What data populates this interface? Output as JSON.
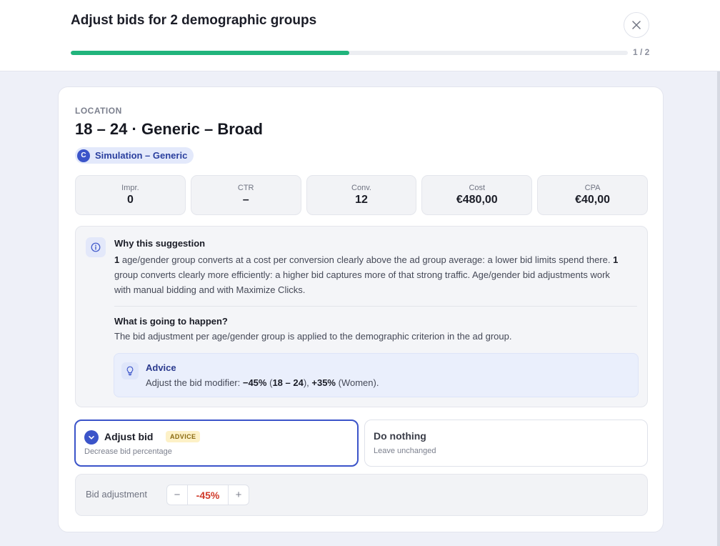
{
  "header": {
    "title": "Adjust bids for 2 demographic groups",
    "progress_text": "1 / 2",
    "progress_fraction": 0.5,
    "progress_color": "#21b47c"
  },
  "location": {
    "label": "LOCATION",
    "name": "18 – 24 · Generic – Broad",
    "campaign_badge": "C",
    "campaign": "Simulation – Generic"
  },
  "stats": [
    {
      "label": "Impr.",
      "value": "0"
    },
    {
      "label": "CTR",
      "value": "–"
    },
    {
      "label": "Conv.",
      "value": "12"
    },
    {
      "label": "Cost",
      "value": "€480,00"
    },
    {
      "label": "CPA",
      "value": "€40,00"
    }
  ],
  "reason": {
    "title": "Why this suggestion",
    "count_1": "1",
    "text_1": " age/gender group converts at a cost per conversion clearly above the ad group average: a lower bid limits spend there. ",
    "count_2": "1",
    "text_2": " group converts clearly more efficiently: a higher bid captures more of that strong traffic. Age/gender bid adjustments work with manual bidding and with Maximize Clicks.",
    "happen_title": "What is going to happen?",
    "happen_text": "The bid adjustment per age/gender group is applied to the demographic criterion in the ad group.",
    "advice_title": "Advice",
    "advice_prefix": "Adjust the bid modifier: ",
    "advice_mod_1": "−45%",
    "advice_open_1": " (",
    "advice_group_1": "18 – 24",
    "advice_close_1": "), ",
    "advice_mod_2": "+35%",
    "advice_group_2": " (Women)."
  },
  "options": {
    "adjust": {
      "title": "Adjust bid",
      "tag": "ADVICE",
      "subtitle": "Decrease bid percentage",
      "selected": true
    },
    "nothing": {
      "title": "Do nothing",
      "subtitle": "Leave unchanged",
      "selected": false
    }
  },
  "bid": {
    "label": "Bid adjustment",
    "minus": "−",
    "value": "-45%",
    "plus": "+"
  },
  "icons": {
    "close": "close-icon",
    "info": "info-icon",
    "bulb": "lightbulb-icon",
    "check": "check-icon"
  },
  "colors": {
    "accent": "#3b54c9",
    "negative": "#d03a2a",
    "tag_bg": "#fdf1c7"
  }
}
